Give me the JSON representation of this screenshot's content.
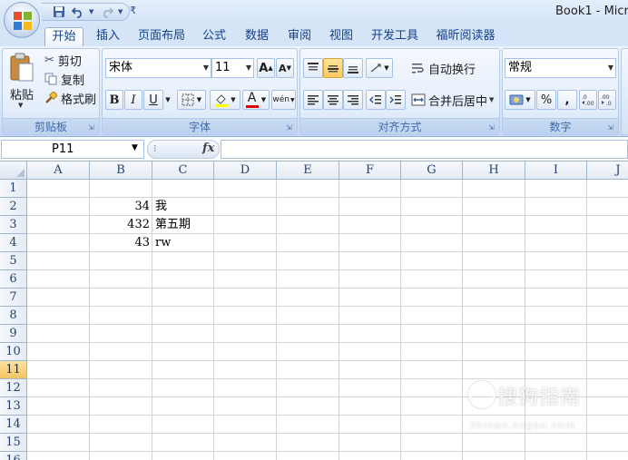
{
  "window": {
    "title": "Book1 - Micr"
  },
  "qat": {
    "customize_glyph": "₹"
  },
  "tabs": [
    {
      "label": "开始",
      "active": true
    },
    {
      "label": "插入"
    },
    {
      "label": "页面布局"
    },
    {
      "label": "公式"
    },
    {
      "label": "数据"
    },
    {
      "label": "审阅"
    },
    {
      "label": "视图"
    },
    {
      "label": "开发工具"
    },
    {
      "label": "福昕阅读器"
    }
  ],
  "clipboard": {
    "label": "剪贴板",
    "paste": "粘贴",
    "cut": "剪切",
    "copy": "复制",
    "format_painter": "格式刷"
  },
  "font": {
    "label": "字体",
    "name": "宋体",
    "size": "11",
    "bold": "B",
    "italic": "I",
    "underline": "U",
    "font_color_glyph": "A",
    "grow_glyph": "A",
    "shrink_glyph": "A",
    "phonetic_glyph": "wén"
  },
  "alignment": {
    "label": "对齐方式",
    "wrap_text": "自动换行",
    "merge_center": "合并后居中"
  },
  "number": {
    "label": "数字",
    "format": "常规",
    "percent": "%",
    "comma": ","
  },
  "formula_bar": {
    "name_box": "P11",
    "fx": "fx",
    "value": ""
  },
  "sheet": {
    "columns": [
      "A",
      "B",
      "C",
      "D",
      "E",
      "F",
      "G",
      "H",
      "I",
      "J"
    ],
    "rows": [
      "1",
      "2",
      "3",
      "4",
      "5",
      "6",
      "7",
      "8",
      "9",
      "10",
      "11",
      "12",
      "13",
      "14",
      "15",
      "16"
    ],
    "active_row": "11",
    "cells": {
      "B2": "34",
      "C2": "我",
      "B3": "432",
      "C3": "第五期",
      "B4": "43",
      "C4": "rw"
    }
  },
  "watermark": {
    "main": "搜狗指南",
    "sub": "zhinan.sogou.com"
  },
  "colors": {
    "accent": "#15428b",
    "active_row": "#f4c462",
    "ribbon": "#dfeafa"
  }
}
